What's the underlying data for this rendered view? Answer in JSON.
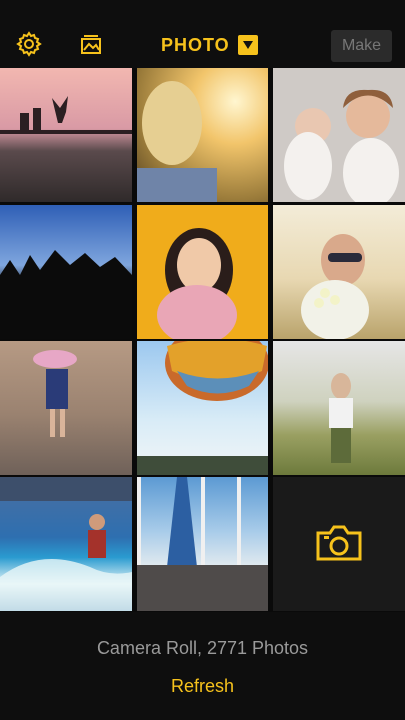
{
  "header": {
    "settings_icon": "gear-icon",
    "album_icon": "album-icon",
    "title": "PHOTO",
    "dropdown_icon": "chevron-down-icon",
    "make_label": "Make",
    "accent_color": "#f6c21c"
  },
  "photos": [
    {
      "description_label": "",
      "icon": "photo-thumbnail"
    }
  ],
  "camera_tile": {
    "icon": "camera-icon"
  },
  "footer": {
    "roll_text": "Camera Roll, 2771 Photos",
    "refresh_label": "Refresh"
  }
}
